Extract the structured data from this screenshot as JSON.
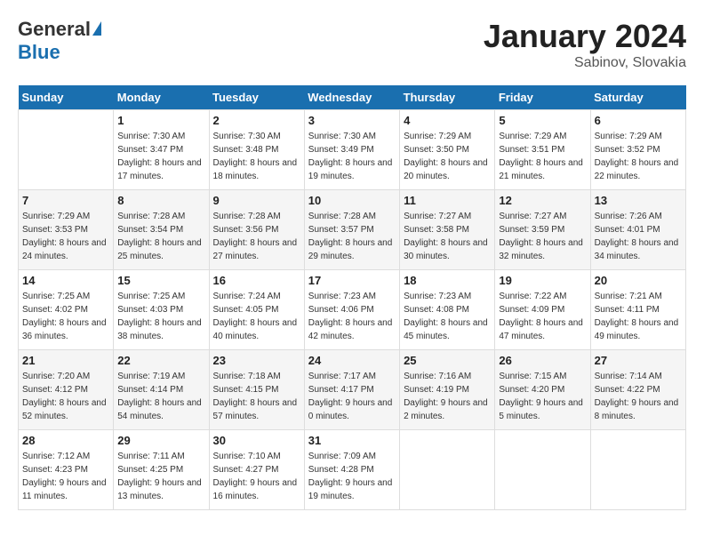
{
  "header": {
    "logo_general": "General",
    "logo_blue": "Blue",
    "month_title": "January 2024",
    "location": "Sabinov, Slovakia"
  },
  "days_of_week": [
    "Sunday",
    "Monday",
    "Tuesday",
    "Wednesday",
    "Thursday",
    "Friday",
    "Saturday"
  ],
  "weeks": [
    [
      {
        "day": "",
        "sunrise": "",
        "sunset": "",
        "daylight": ""
      },
      {
        "day": "1",
        "sunrise": "Sunrise: 7:30 AM",
        "sunset": "Sunset: 3:47 PM",
        "daylight": "Daylight: 8 hours and 17 minutes."
      },
      {
        "day": "2",
        "sunrise": "Sunrise: 7:30 AM",
        "sunset": "Sunset: 3:48 PM",
        "daylight": "Daylight: 8 hours and 18 minutes."
      },
      {
        "day": "3",
        "sunrise": "Sunrise: 7:30 AM",
        "sunset": "Sunset: 3:49 PM",
        "daylight": "Daylight: 8 hours and 19 minutes."
      },
      {
        "day": "4",
        "sunrise": "Sunrise: 7:29 AM",
        "sunset": "Sunset: 3:50 PM",
        "daylight": "Daylight: 8 hours and 20 minutes."
      },
      {
        "day": "5",
        "sunrise": "Sunrise: 7:29 AM",
        "sunset": "Sunset: 3:51 PM",
        "daylight": "Daylight: 8 hours and 21 minutes."
      },
      {
        "day": "6",
        "sunrise": "Sunrise: 7:29 AM",
        "sunset": "Sunset: 3:52 PM",
        "daylight": "Daylight: 8 hours and 22 minutes."
      }
    ],
    [
      {
        "day": "7",
        "sunrise": "Sunrise: 7:29 AM",
        "sunset": "Sunset: 3:53 PM",
        "daylight": "Daylight: 8 hours and 24 minutes."
      },
      {
        "day": "8",
        "sunrise": "Sunrise: 7:28 AM",
        "sunset": "Sunset: 3:54 PM",
        "daylight": "Daylight: 8 hours and 25 minutes."
      },
      {
        "day": "9",
        "sunrise": "Sunrise: 7:28 AM",
        "sunset": "Sunset: 3:56 PM",
        "daylight": "Daylight: 8 hours and 27 minutes."
      },
      {
        "day": "10",
        "sunrise": "Sunrise: 7:28 AM",
        "sunset": "Sunset: 3:57 PM",
        "daylight": "Daylight: 8 hours and 29 minutes."
      },
      {
        "day": "11",
        "sunrise": "Sunrise: 7:27 AM",
        "sunset": "Sunset: 3:58 PM",
        "daylight": "Daylight: 8 hours and 30 minutes."
      },
      {
        "day": "12",
        "sunrise": "Sunrise: 7:27 AM",
        "sunset": "Sunset: 3:59 PM",
        "daylight": "Daylight: 8 hours and 32 minutes."
      },
      {
        "day": "13",
        "sunrise": "Sunrise: 7:26 AM",
        "sunset": "Sunset: 4:01 PM",
        "daylight": "Daylight: 8 hours and 34 minutes."
      }
    ],
    [
      {
        "day": "14",
        "sunrise": "Sunrise: 7:25 AM",
        "sunset": "Sunset: 4:02 PM",
        "daylight": "Daylight: 8 hours and 36 minutes."
      },
      {
        "day": "15",
        "sunrise": "Sunrise: 7:25 AM",
        "sunset": "Sunset: 4:03 PM",
        "daylight": "Daylight: 8 hours and 38 minutes."
      },
      {
        "day": "16",
        "sunrise": "Sunrise: 7:24 AM",
        "sunset": "Sunset: 4:05 PM",
        "daylight": "Daylight: 8 hours and 40 minutes."
      },
      {
        "day": "17",
        "sunrise": "Sunrise: 7:23 AM",
        "sunset": "Sunset: 4:06 PM",
        "daylight": "Daylight: 8 hours and 42 minutes."
      },
      {
        "day": "18",
        "sunrise": "Sunrise: 7:23 AM",
        "sunset": "Sunset: 4:08 PM",
        "daylight": "Daylight: 8 hours and 45 minutes."
      },
      {
        "day": "19",
        "sunrise": "Sunrise: 7:22 AM",
        "sunset": "Sunset: 4:09 PM",
        "daylight": "Daylight: 8 hours and 47 minutes."
      },
      {
        "day": "20",
        "sunrise": "Sunrise: 7:21 AM",
        "sunset": "Sunset: 4:11 PM",
        "daylight": "Daylight: 8 hours and 49 minutes."
      }
    ],
    [
      {
        "day": "21",
        "sunrise": "Sunrise: 7:20 AM",
        "sunset": "Sunset: 4:12 PM",
        "daylight": "Daylight: 8 hours and 52 minutes."
      },
      {
        "day": "22",
        "sunrise": "Sunrise: 7:19 AM",
        "sunset": "Sunset: 4:14 PM",
        "daylight": "Daylight: 8 hours and 54 minutes."
      },
      {
        "day": "23",
        "sunrise": "Sunrise: 7:18 AM",
        "sunset": "Sunset: 4:15 PM",
        "daylight": "Daylight: 8 hours and 57 minutes."
      },
      {
        "day": "24",
        "sunrise": "Sunrise: 7:17 AM",
        "sunset": "Sunset: 4:17 PM",
        "daylight": "Daylight: 9 hours and 0 minutes."
      },
      {
        "day": "25",
        "sunrise": "Sunrise: 7:16 AM",
        "sunset": "Sunset: 4:19 PM",
        "daylight": "Daylight: 9 hours and 2 minutes."
      },
      {
        "day": "26",
        "sunrise": "Sunrise: 7:15 AM",
        "sunset": "Sunset: 4:20 PM",
        "daylight": "Daylight: 9 hours and 5 minutes."
      },
      {
        "day": "27",
        "sunrise": "Sunrise: 7:14 AM",
        "sunset": "Sunset: 4:22 PM",
        "daylight": "Daylight: 9 hours and 8 minutes."
      }
    ],
    [
      {
        "day": "28",
        "sunrise": "Sunrise: 7:12 AM",
        "sunset": "Sunset: 4:23 PM",
        "daylight": "Daylight: 9 hours and 11 minutes."
      },
      {
        "day": "29",
        "sunrise": "Sunrise: 7:11 AM",
        "sunset": "Sunset: 4:25 PM",
        "daylight": "Daylight: 9 hours and 13 minutes."
      },
      {
        "day": "30",
        "sunrise": "Sunrise: 7:10 AM",
        "sunset": "Sunset: 4:27 PM",
        "daylight": "Daylight: 9 hours and 16 minutes."
      },
      {
        "day": "31",
        "sunrise": "Sunrise: 7:09 AM",
        "sunset": "Sunset: 4:28 PM",
        "daylight": "Daylight: 9 hours and 19 minutes."
      },
      {
        "day": "",
        "sunrise": "",
        "sunset": "",
        "daylight": ""
      },
      {
        "day": "",
        "sunrise": "",
        "sunset": "",
        "daylight": ""
      },
      {
        "day": "",
        "sunrise": "",
        "sunset": "",
        "daylight": ""
      }
    ]
  ]
}
